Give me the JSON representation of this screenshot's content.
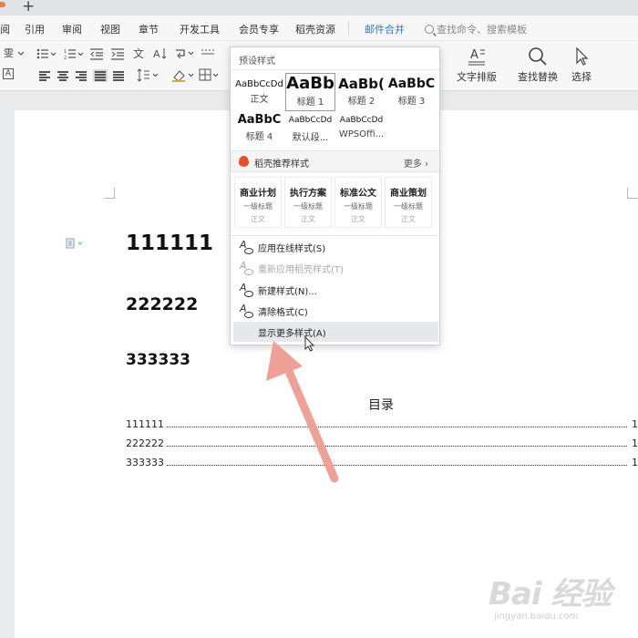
{
  "menubar": {
    "items": [
      {
        "label": "阅"
      },
      {
        "label": "引用"
      },
      {
        "label": "审阅"
      },
      {
        "label": "视图"
      },
      {
        "label": "章节"
      },
      {
        "label": "开发工具"
      },
      {
        "label": "会员专享"
      },
      {
        "label": "稻壳资源"
      },
      {
        "label": "邮件合并",
        "accent": true
      }
    ],
    "search_placeholder": "查找命令、搜索模板",
    "tab_plus": "+"
  },
  "toolbar": {
    "text_layout_label": "文字排版",
    "find_replace_label": "查找替换",
    "select_label": "选择"
  },
  "dropdown": {
    "preset_header": "预设样式",
    "styles": [
      {
        "sample": "AaBbCcDd",
        "name": "正文"
      },
      {
        "sample": "AaBb",
        "name": "标题 1",
        "selected": true
      },
      {
        "sample": "AaBb(",
        "name": "标题 2"
      },
      {
        "sample": "AaBbC",
        "name": "标题 3"
      },
      {
        "sample": "AaBbC",
        "name": "标题 4"
      },
      {
        "sample": "AaBbCcDd",
        "name": "默认段..."
      },
      {
        "sample": "AaBbCcDd",
        "name": "WPSOffi..."
      }
    ],
    "recommend_label": "稻壳推荐样式",
    "more_label": "更多",
    "recommend_items": [
      {
        "title": "商业计划",
        "sub": "一级标题",
        "body": "正文"
      },
      {
        "title": "执行方案",
        "sub": "一级标题",
        "body": "正文"
      },
      {
        "title": "标准公文",
        "sub": "一级标题",
        "body": "正文"
      },
      {
        "title": "商业策划",
        "sub": "一级标题",
        "body": "正文"
      }
    ],
    "actions": [
      {
        "label": "应用在线样式(S)",
        "disabled": false
      },
      {
        "label": "重新应用稻壳样式(T)",
        "disabled": true
      },
      {
        "label": "新建样式(N)...",
        "disabled": false
      },
      {
        "label": "清除格式(C)",
        "disabled": false
      },
      {
        "label": "显示更多样式(A)",
        "disabled": false,
        "hover": true
      }
    ]
  },
  "document": {
    "heading1": "111111",
    "heading2": "222222",
    "heading3": "333333",
    "toc_title": "目录",
    "toc": [
      {
        "text": "111111",
        "page": "1"
      },
      {
        "text": "222222",
        "page": "1"
      },
      {
        "text": "333333",
        "page": "1"
      }
    ]
  },
  "annotation": {
    "arrow_color": "#f0a197"
  },
  "watermark": {
    "brand": "Bai 经验",
    "url": "jingyan.baidu.com"
  }
}
